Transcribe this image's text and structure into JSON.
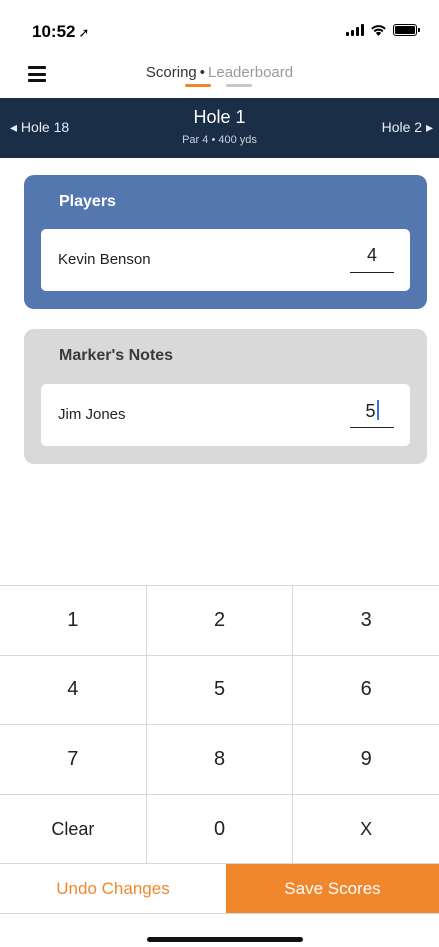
{
  "status_bar": {
    "time": "10:52",
    "location_glyph": "➚"
  },
  "tabs": {
    "active": "Scoring",
    "separator": "•",
    "inactive": "Leaderboard"
  },
  "hole_nav": {
    "prev": "◂ Hole 18",
    "title": "Hole 1",
    "subtitle": "Par 4 • 400 yds",
    "next": "Hole 2 ▸"
  },
  "players_card": {
    "title": "Players",
    "player": {
      "name": "Kevin Benson",
      "score": "4"
    }
  },
  "marker_card": {
    "title": "Marker's Notes",
    "player": {
      "name": "Jim Jones",
      "score": "5"
    }
  },
  "keypad": {
    "rows": [
      [
        "1",
        "2",
        "3"
      ],
      [
        "4",
        "5",
        "6"
      ],
      [
        "7",
        "8",
        "9"
      ],
      [
        "Clear",
        "0",
        "X"
      ]
    ]
  },
  "actions": {
    "undo": "Undo Changes",
    "save": "Save Scores"
  },
  "colors": {
    "accent": "#f0872d",
    "nav_bg": "#1a2e48",
    "players_card_bg": "#5577b0",
    "marker_card_bg": "#d9d9d9"
  }
}
